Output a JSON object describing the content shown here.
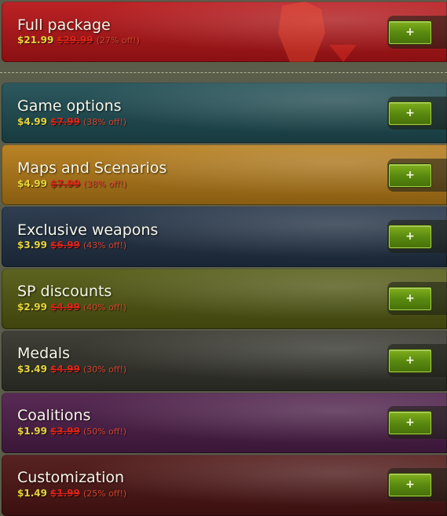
{
  "add_label": "+",
  "items": [
    {
      "title": "Full package",
      "new_price": "$21.99",
      "old_price": "$29.99",
      "discount": "(27% off!)",
      "color": "#b81518"
    },
    {
      "title": "Game options",
      "new_price": "$4.99",
      "old_price": "$7.99",
      "discount": "(38% off!)",
      "color": "#1f4e54"
    },
    {
      "title": "Maps and Scenarios",
      "new_price": "$4.99",
      "old_price": "$7.99",
      "discount": "(38% off!)",
      "color": "#b67c18"
    },
    {
      "title": "Exclusive weapons",
      "new_price": "$3.99",
      "old_price": "$6.99",
      "discount": "(43% off!)",
      "color": "#223246"
    },
    {
      "title": "SP discounts",
      "new_price": "$2.99",
      "old_price": "$4.99",
      "discount": "(40% off!)",
      "color": "#535a12"
    },
    {
      "title": "Medals",
      "new_price": "$3.49",
      "old_price": "$4.99",
      "discount": "(30% off!)",
      "color": "#34342c"
    },
    {
      "title": "Coalitions",
      "new_price": "$1.99",
      "old_price": "$3.99",
      "discount": "(50% off!)",
      "color": "#4e1e4a"
    },
    {
      "title": "Customization",
      "new_price": "$1.49",
      "old_price": "$1.99",
      "discount": "(25% off!)",
      "color": "#4e1514"
    }
  ]
}
